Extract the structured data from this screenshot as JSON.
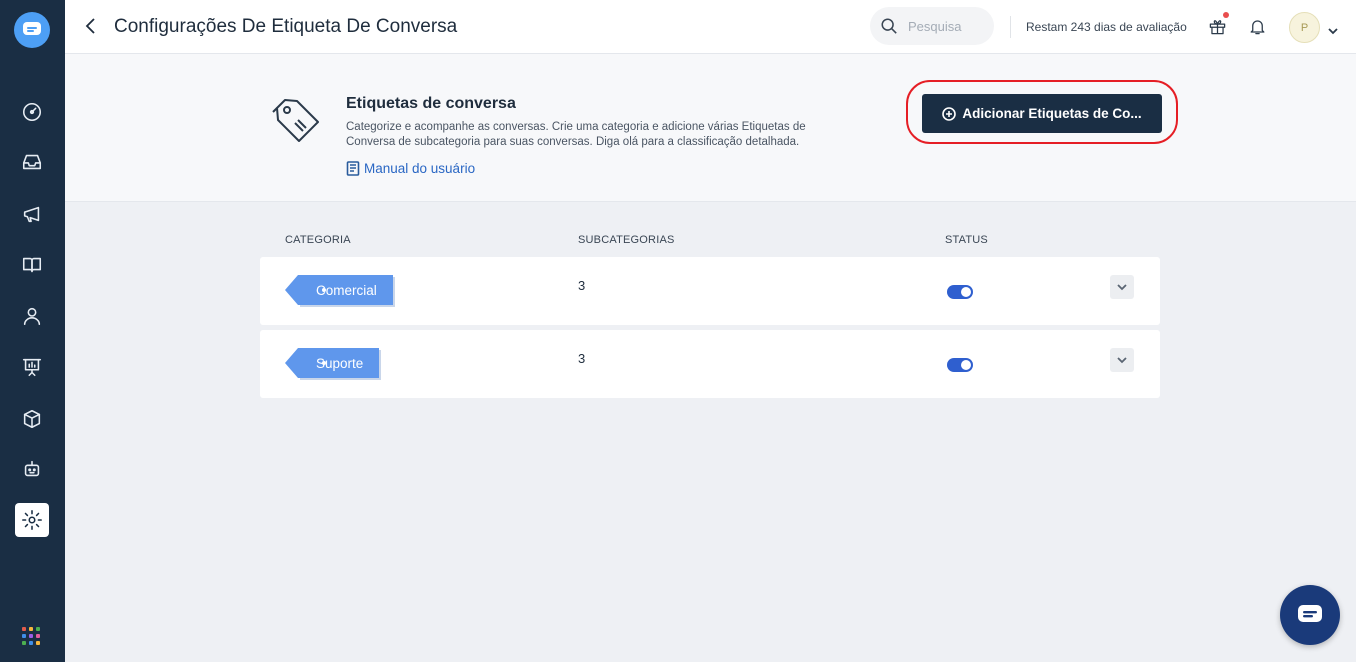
{
  "header": {
    "title": "Configurações De Etiqueta De Conversa",
    "search_placeholder": "Pesquisa",
    "trial_text": "Restam 243 dias de avaliação",
    "avatar_initial": "P"
  },
  "info": {
    "title": "Etiquetas de conversa",
    "description": "Categorize e acompanhe as conversas. Crie uma categoria e adicione várias Etiquetas de Conversa de subcategoria para suas conversas. Diga olá para a classificação detalhada.",
    "manual_link": "Manual do usuário",
    "add_button": "Adicionar Etiquetas de Co..."
  },
  "table": {
    "columns": [
      "CATEGORIA",
      "SUBCATEGORIAS",
      "STATUS"
    ],
    "rows": [
      {
        "category": "Comercial",
        "subcategories": "3",
        "status": "on"
      },
      {
        "category": "Suporte",
        "subcategories": "3",
        "status": "on"
      }
    ]
  },
  "sidebar": {
    "items": [
      "dashboard-icon",
      "inbox-icon",
      "campaigns-icon",
      "knowledge-base-icon",
      "contacts-icon",
      "reports-icon",
      "integrations-icon",
      "bots-icon",
      "settings-icon"
    ],
    "active": "settings-icon"
  },
  "colors": {
    "sidebar": "#1a2e44",
    "accent": "#4d9ff5",
    "tag": "#5f97ec",
    "toggle": "#2f5fcf",
    "highlight_ring": "#e51e25"
  }
}
